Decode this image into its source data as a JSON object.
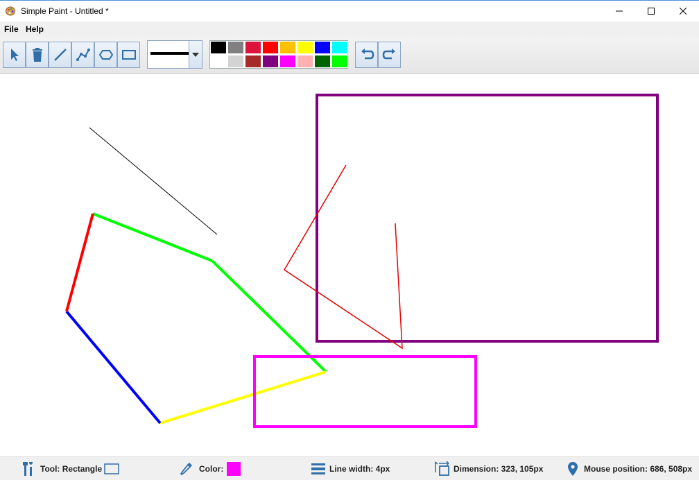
{
  "window": {
    "title": "Simple Paint - Untitled *"
  },
  "menu": {
    "file": "File",
    "help": "Help"
  },
  "toolbar": {
    "tools": [
      {
        "name": "select",
        "icon": "pointer-icon"
      },
      {
        "name": "delete",
        "icon": "trash-icon"
      },
      {
        "name": "line",
        "icon": "line-icon"
      },
      {
        "name": "polyline",
        "icon": "polyline-icon"
      },
      {
        "name": "polygon",
        "icon": "polygon-icon"
      },
      {
        "name": "rectangle",
        "icon": "rectangle-icon"
      }
    ],
    "undo": "undo-icon",
    "redo": "redo-icon",
    "line_width_preview": "thick black line"
  },
  "palette": {
    "row1": [
      "#000000",
      "#808080",
      "#dc143c",
      "#ff0000",
      "#ffc000",
      "#ffff00",
      "#0000ff",
      "#00ffff"
    ],
    "row2": [
      "#ffffff",
      "#d3d3d3",
      "#a52a2a",
      "#800080",
      "#ff00ff",
      "#ffb0b0",
      "#006400",
      "#00ff00"
    ]
  },
  "status": {
    "tool": "Tool: Rectangle",
    "color_label": "Color:",
    "color_value": "#ff00ff",
    "line_width": "Line width: 4px",
    "dimension": "Dimension: 323, 105px",
    "mouse_position": "Mouse position: 686, 508px"
  },
  "drawing": {
    "shapes": [
      {
        "type": "line",
        "color": "#000000",
        "width": 1
      },
      {
        "type": "polygon-edges",
        "colors": [
          "#00ff00",
          "#00ff00",
          "#ffff00",
          "#0000ff",
          "#ff0000"
        ],
        "width": 4
      },
      {
        "type": "polyline",
        "color": "#ff0000",
        "width": 1.5
      },
      {
        "type": "rectangle",
        "color": "#800080",
        "width": 4
      },
      {
        "type": "rectangle",
        "color": "#ff00ff",
        "width": 4
      }
    ]
  }
}
